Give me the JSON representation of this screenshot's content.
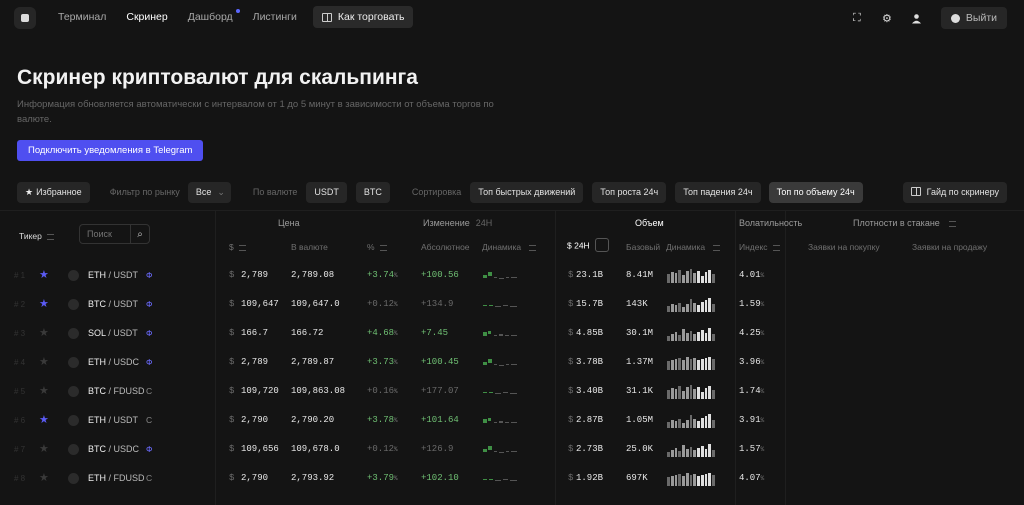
{
  "nav": {
    "items": [
      {
        "label": "Терминал",
        "active": false,
        "dot": false
      },
      {
        "label": "Скринер",
        "active": true,
        "dot": false
      },
      {
        "label": "Дашборд",
        "active": false,
        "dot": true
      },
      {
        "label": "Листинги",
        "active": false,
        "dot": false
      }
    ],
    "how_to_trade": "Как торговать",
    "logout": "Выйти",
    "icons": [
      "fullscreen-icon",
      "gear-icon",
      "user-icon"
    ]
  },
  "page": {
    "title": "Скринер криптовалют для скальпинга",
    "subtitle": "Информация обновляется автоматически с интервалом от 1 до 5 минут в зависимости от объема торгов по валюте.",
    "telegram_button": "Подключить уведомления в Telegram"
  },
  "filters": {
    "favorites": "Избранное",
    "market_label": "Фильтр по рынку",
    "market_value": "Все",
    "currency_label": "По валюте",
    "currency_options": [
      "USDT",
      "BTC"
    ],
    "sort_label": "Сортировка",
    "sort_options": [
      {
        "label": "Топ быстрых движений",
        "selected": false
      },
      {
        "label": "Топ роста 24ч",
        "selected": false
      },
      {
        "label": "Топ падения 24ч",
        "selected": false
      },
      {
        "label": "Топ по объему 24ч",
        "selected": true
      }
    ],
    "guide": "Гайд по скринеру"
  },
  "table": {
    "groups": {
      "price": "Цена",
      "change": "Изменение",
      "change_suffix": "24Н",
      "volume": "Объем",
      "volatility": "Волатильность",
      "density": "Плотности в стакане"
    },
    "ticker_header": "Тикер",
    "search_placeholder": "Поиск",
    "columns": {
      "price_usd": "$",
      "price_in_currency": "В валюте",
      "change_pct": "%",
      "change_abs": "Абсолютное",
      "change_dyn": "Динамика",
      "vol_24h": "$ 24Н",
      "vol_base": "Базовый",
      "vol_dyn": "Динамика",
      "volatility_index": "Индекс",
      "bids": "Заявки на покупку",
      "asks": "Заявки на продажу"
    },
    "rows": [
      {
        "num": "# 1",
        "fav": true,
        "base": "ETH",
        "quote": "USDT",
        "badge": "Ф",
        "price": "2,789",
        "price_cur": "2,789.08",
        "pct": "+3.74",
        "pct_dir": "up",
        "abs": "+100.56",
        "abs_dir": "up",
        "vol": "23.1B",
        "vol_base": "8.41M",
        "vola": "4.01"
      },
      {
        "num": "# 2",
        "fav": true,
        "base": "BTC",
        "quote": "USDT",
        "badge": "Ф",
        "price": "109,647",
        "price_cur": "109,647.0",
        "pct": "+0.12",
        "pct_dir": "flat",
        "abs": "+134.9",
        "abs_dir": "flat",
        "vol": "15.7B",
        "vol_base": "143K",
        "vola": "1.59"
      },
      {
        "num": "# 3",
        "fav": false,
        "base": "SOL",
        "quote": "USDT",
        "badge": "Ф",
        "price": "166.7",
        "price_cur": "166.72",
        "pct": "+4.68",
        "pct_dir": "up",
        "abs": "+7.45",
        "abs_dir": "up",
        "vol": "4.85B",
        "vol_base": "30.1M",
        "vola": "4.25"
      },
      {
        "num": "# 4",
        "fav": false,
        "base": "ETH",
        "quote": "USDC",
        "badge": "Ф",
        "price": "2,789",
        "price_cur": "2,789.87",
        "pct": "+3.73",
        "pct_dir": "up",
        "abs": "+100.45",
        "abs_dir": "up",
        "vol": "3.78B",
        "vol_base": "1.37M",
        "vola": "3.96"
      },
      {
        "num": "# 5",
        "fav": false,
        "base": "BTC",
        "quote": "FDUSD",
        "badge": "С",
        "price": "109,720",
        "price_cur": "109,863.08",
        "pct": "+0.16",
        "pct_dir": "flat",
        "abs": "+177.07",
        "abs_dir": "flat",
        "vol": "3.40B",
        "vol_base": "31.1K",
        "vola": "1.74"
      },
      {
        "num": "# 6",
        "fav": true,
        "base": "ETH",
        "quote": "USDT",
        "badge": "С",
        "price": "2,790",
        "price_cur": "2,790.20",
        "pct": "+3.78",
        "pct_dir": "up",
        "abs": "+101.64",
        "abs_dir": "up",
        "vol": "2.87B",
        "vol_base": "1.05M",
        "vola": "3.91"
      },
      {
        "num": "# 7",
        "fav": false,
        "base": "BTC",
        "quote": "USDC",
        "badge": "Ф",
        "price": "109,656",
        "price_cur": "109,678.0",
        "pct": "+0.12",
        "pct_dir": "flat",
        "abs": "+126.9",
        "abs_dir": "flat",
        "vol": "2.73B",
        "vol_base": "25.0K",
        "vola": "1.57"
      },
      {
        "num": "# 8",
        "fav": false,
        "base": "ETH",
        "quote": "FDUSD",
        "badge": "С",
        "price": "2,790",
        "price_cur": "2,793.92",
        "pct": "+3.79",
        "pct_dir": "up",
        "abs": "+102.10",
        "abs_dir": "up",
        "vol": "1.92B",
        "vol_base": "697K",
        "vola": "4.07"
      }
    ]
  },
  "colors": {
    "background": "#141414",
    "accent": "#4f4ff0",
    "positive": "#6fbf73",
    "futures_badge": "#6b6bff",
    "spot_badge": "#8a8a8a"
  }
}
